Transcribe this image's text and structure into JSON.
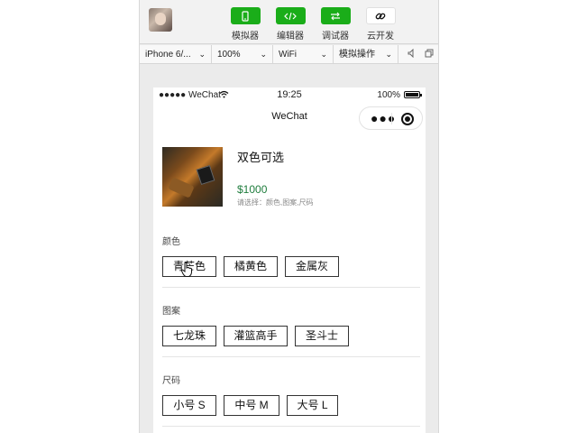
{
  "toolbar": {
    "tools": [
      {
        "label": "模拟器",
        "icon": "phone-icon"
      },
      {
        "label": "编辑器",
        "icon": "code-icon"
      },
      {
        "label": "调试器",
        "icon": "debug-icon"
      },
      {
        "label": "云开发",
        "icon": "cloud-link-icon"
      }
    ]
  },
  "devbar": {
    "device": "iPhone 6/...",
    "zoom": "100%",
    "network": "WiFi",
    "operation": "模拟操作"
  },
  "status_bar": {
    "carrier": "●●●●● WeChat",
    "time": "19:25",
    "battery": "100%"
  },
  "navbar": {
    "title": "WeChat"
  },
  "product": {
    "name": "双色可选",
    "price": "$1000",
    "hint": "请选择：颜色,图案,尺码"
  },
  "sections": [
    {
      "title": "颜色",
      "options": [
        "青芒色",
        "橘黄色",
        "金属灰"
      ]
    },
    {
      "title": "图案",
      "options": [
        "七龙珠",
        "灌篮高手",
        "圣斗士"
      ]
    },
    {
      "title": "尺码",
      "options": [
        "小号 S",
        "中号 M",
        "大号 L"
      ]
    }
  ],
  "colors": {
    "accent": "#1aad19",
    "price": "#1f7d3d"
  }
}
